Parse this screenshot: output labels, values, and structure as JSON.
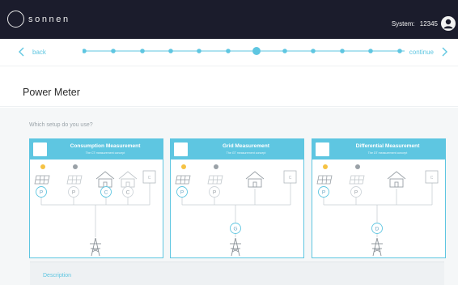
{
  "header": {
    "logo_text": "sonnen",
    "system_label": "System:",
    "system_id": "12345",
    "user_icon": "user-avatar-icon"
  },
  "stepper": {
    "back_label": "back",
    "continue_label": "continue",
    "step_count": 12,
    "active_step": 7,
    "accent": "#5ec6e1"
  },
  "page": {
    "title": "Power Meter"
  },
  "setup": {
    "question": "Which setup do you use?",
    "options": [
      {
        "title": "Consumption Measurement",
        "subtitle": "The CT measurement concept",
        "meters": [
          "P",
          "P",
          "C",
          "C"
        ]
      },
      {
        "title": "Grid Measurement",
        "subtitle": "The GT measurement concept",
        "meters": [
          "P",
          "P",
          "G"
        ]
      },
      {
        "title": "Differential Measurement",
        "subtitle": "The DT measurement concept",
        "meters": [
          "P",
          "P",
          "D"
        ]
      }
    ],
    "icons": [
      "sun-icon",
      "moon-icon",
      "solar-panel-icon",
      "house-icon",
      "storage-box-icon",
      "meter-icon",
      "power-tower-icon"
    ],
    "box_label": "C"
  },
  "description": {
    "label": "Description"
  },
  "colors": {
    "topbar": "#1b1c2c",
    "accent": "#5ec6e1",
    "sun": "#f5c243",
    "icon_gray": "#9aa1a7",
    "panel": "#eef1f3"
  }
}
